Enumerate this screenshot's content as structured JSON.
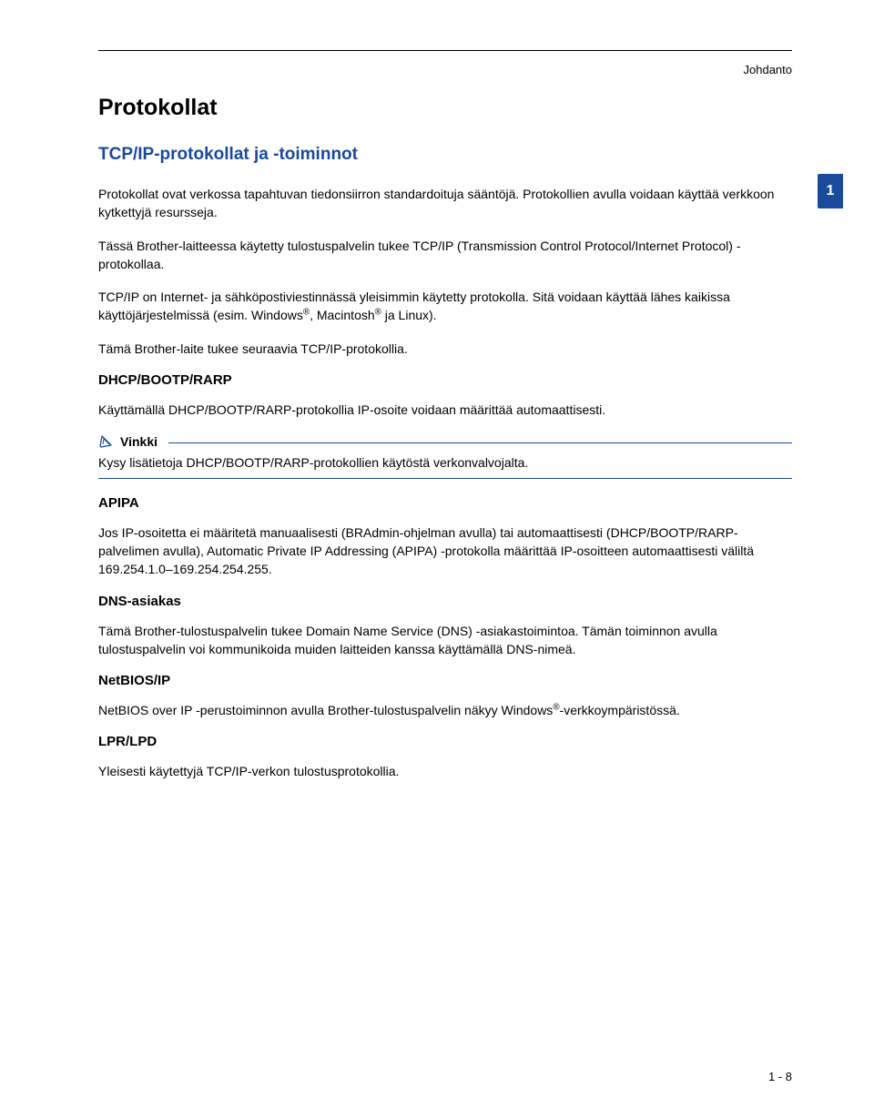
{
  "header": {
    "context": "Johdanto",
    "chapter_number": "1"
  },
  "title": "Protokollat",
  "section_title": "TCP/IP-protokollat ja -toiminnot",
  "para1": "Protokollat ovat verkossa tapahtuvan tiedonsiirron standardoituja sääntöjä. Protokollien avulla voidaan käyttää verkkoon kytkettyjä resursseja.",
  "para2": "Tässä Brother-laitteessa käytetty tulostuspalvelin tukee TCP/IP (Transmission Control Protocol/Internet Protocol) -protokollaa.",
  "para3_a": "TCP/IP on Internet- ja sähköpostiviestinnässä yleisimmin käytetty protokolla. Sitä voidaan käyttää lähes kaikissa käyttöjärjestelmissä (esim. Windows",
  "para3_b": ", Macintosh",
  "para3_c": " ja Linux).",
  "para4": "Tämä Brother-laite tukee seuraavia TCP/IP-protokollia.",
  "dhcp": {
    "title": "DHCP/BOOTP/RARP",
    "body": "Käyttämällä DHCP/BOOTP/RARP-protokollia IP-osoite voidaan määrittää automaattisesti."
  },
  "note": {
    "label": "Vinkki",
    "body": "Kysy lisätietoja DHCP/BOOTP/RARP-protokollien käytöstä verkonvalvojalta."
  },
  "apipa": {
    "title": "APIPA",
    "body": "Jos IP-osoitetta ei määritetä manuaalisesti (BRAdmin-ohjelman avulla) tai automaattisesti (DHCP/BOOTP/RARP-palvelimen avulla), Automatic Private IP Addressing (APIPA) -protokolla määrittää IP-osoitteen automaattisesti väliltä 169.254.1.0–169.254.254.255."
  },
  "dns": {
    "title": "DNS-asiakas",
    "body": "Tämä Brother-tulostuspalvelin tukee Domain Name Service (DNS) -asiakastoimintoa. Tämän toiminnon avulla tulostuspalvelin voi kommunikoida muiden laitteiden kanssa käyttämällä DNS-nimeä."
  },
  "netbios": {
    "title": "NetBIOS/IP",
    "body_a": "NetBIOS over IP -perustoiminnon avulla Brother-tulostuspalvelin näkyy Windows",
    "body_b": "-verkkoympäristössä."
  },
  "lpr": {
    "title": "LPR/LPD",
    "body": "Yleisesti käytettyjä TCP/IP-verkon tulostusprotokollia."
  },
  "footer": {
    "page": "1 - 8"
  }
}
